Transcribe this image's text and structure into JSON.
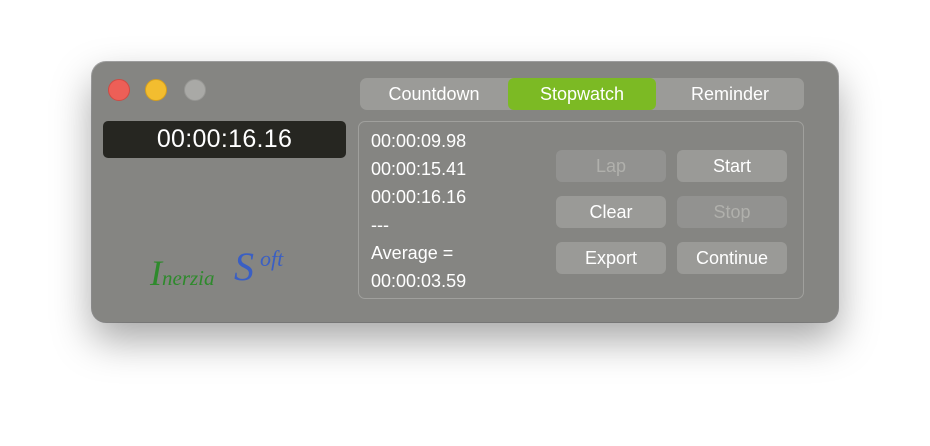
{
  "timer": {
    "display": "00:00:16.16"
  },
  "tabs": [
    {
      "label": "Countdown",
      "active": false
    },
    {
      "label": "Stopwatch",
      "active": true
    },
    {
      "label": "Reminder",
      "active": false
    }
  ],
  "laps": [
    "00:00:09.98",
    "00:00:15.41",
    "00:00:16.16",
    "---",
    "Average =",
    "00:00:03.59"
  ],
  "buttons": {
    "lap": {
      "label": "Lap",
      "enabled": false
    },
    "start": {
      "label": "Start",
      "enabled": true
    },
    "clear": {
      "label": "Clear",
      "enabled": true
    },
    "stop": {
      "label": "Stop",
      "enabled": false
    },
    "export": {
      "label": "Export",
      "enabled": true
    },
    "continue": {
      "label": "Continue",
      "enabled": true
    }
  },
  "logo": {
    "part1_initial": "I",
    "part1_rest": "nerzia",
    "part2_initial": "S",
    "part2_rest": "oft",
    "color1": "#2e8a2c",
    "color2": "#3a5fc4"
  },
  "colors": {
    "window": "#858582",
    "accent": "#7cba24",
    "display_bg": "#262621",
    "close": "#ed5f57",
    "minimize": "#f3bd2f",
    "zoom": "#a9a9a6"
  }
}
